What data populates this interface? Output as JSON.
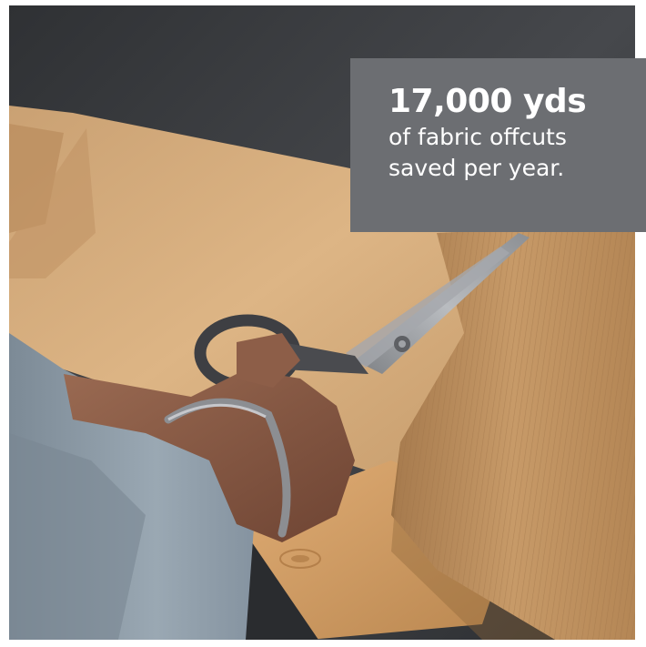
{
  "stat": {
    "number": "17,000 yds",
    "caption_line1": "of fabric offcuts",
    "caption_line2": "saved per year."
  },
  "photo": {
    "subject": "hand-cutting-fabric-with-scissors",
    "colors": {
      "background_fabric": "#3d3f43",
      "paper": "#d6ab78",
      "fabric": "#bf9263",
      "sleeve": "#8c9aa6",
      "skin": "#8a5a44",
      "scissors": "#4a4b4f",
      "blade": "#9c9fa3",
      "wood": "#d8a36c"
    }
  }
}
